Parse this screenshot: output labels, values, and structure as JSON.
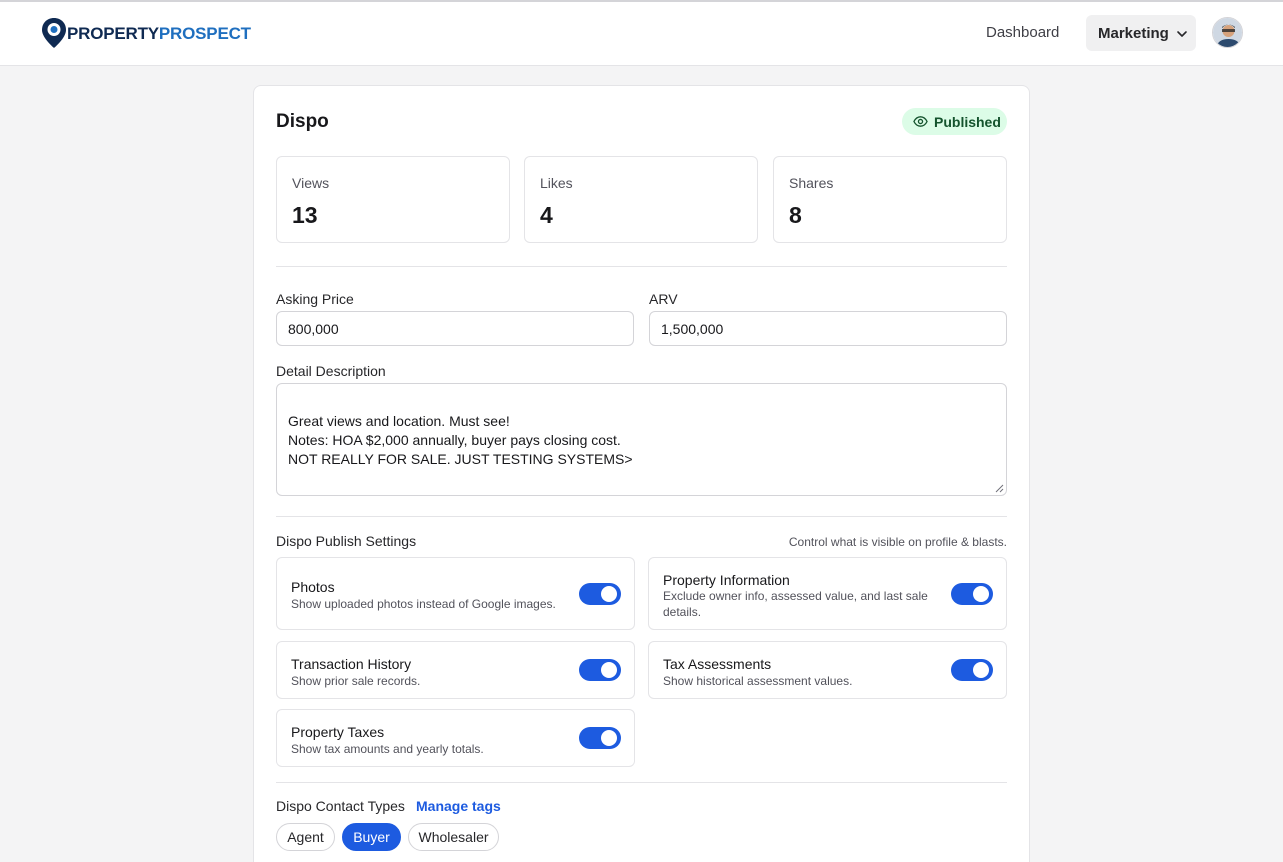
{
  "header": {
    "logo": {
      "part1": "PROPERTY",
      "part2": "PROSPECT"
    },
    "nav": {
      "dashboard": "Dashboard",
      "marketing": "Marketing"
    }
  },
  "card": {
    "title": "Dispo",
    "status": "Published",
    "stats": [
      {
        "label": "Views",
        "value": "13"
      },
      {
        "label": "Likes",
        "value": "4"
      },
      {
        "label": "Shares",
        "value": "8"
      }
    ],
    "form": {
      "asking_price_label": "Asking Price",
      "asking_price_value": "800,000",
      "arv_label": "ARV",
      "arv_value": "1,500,000",
      "description_label": "Detail Description",
      "description_value": "Great views and location. Must see!\nNotes: HOA $2,000 annually, buyer pays closing cost.\nNOT REALLY FOR SALE. JUST TESTING SYSTEMS>"
    },
    "publish_settings": {
      "title": "Dispo Publish Settings",
      "hint": "Control what is visible on profile & blasts.",
      "items": [
        {
          "title": "Photos",
          "description": "Show uploaded photos instead of Google images.",
          "enabled": true
        },
        {
          "title": "Property Information",
          "description": "Exclude owner info, assessed value, and last sale details.",
          "enabled": true
        },
        {
          "title": "Transaction History",
          "description": "Show prior sale records.",
          "enabled": true
        },
        {
          "title": "Tax Assessments",
          "description": "Show historical assessment values.",
          "enabled": true
        },
        {
          "title": "Property Taxes",
          "description": "Show tax amounts and yearly totals.",
          "enabled": true
        }
      ]
    },
    "contact_types": {
      "label": "Dispo Contact Types",
      "manage_label": "Manage tags",
      "tags": [
        {
          "label": "Agent",
          "selected": false
        },
        {
          "label": "Buyer",
          "selected": true
        },
        {
          "label": "Wholesaler",
          "selected": false
        }
      ]
    }
  },
  "colors": {
    "accent": "#1d5be0",
    "published_bg": "#dcfce7",
    "published_text": "#14532d"
  },
  "icons": {
    "logo": "map-pin-icon",
    "status": "eye-icon",
    "dropdown": "chevron-down-icon"
  }
}
